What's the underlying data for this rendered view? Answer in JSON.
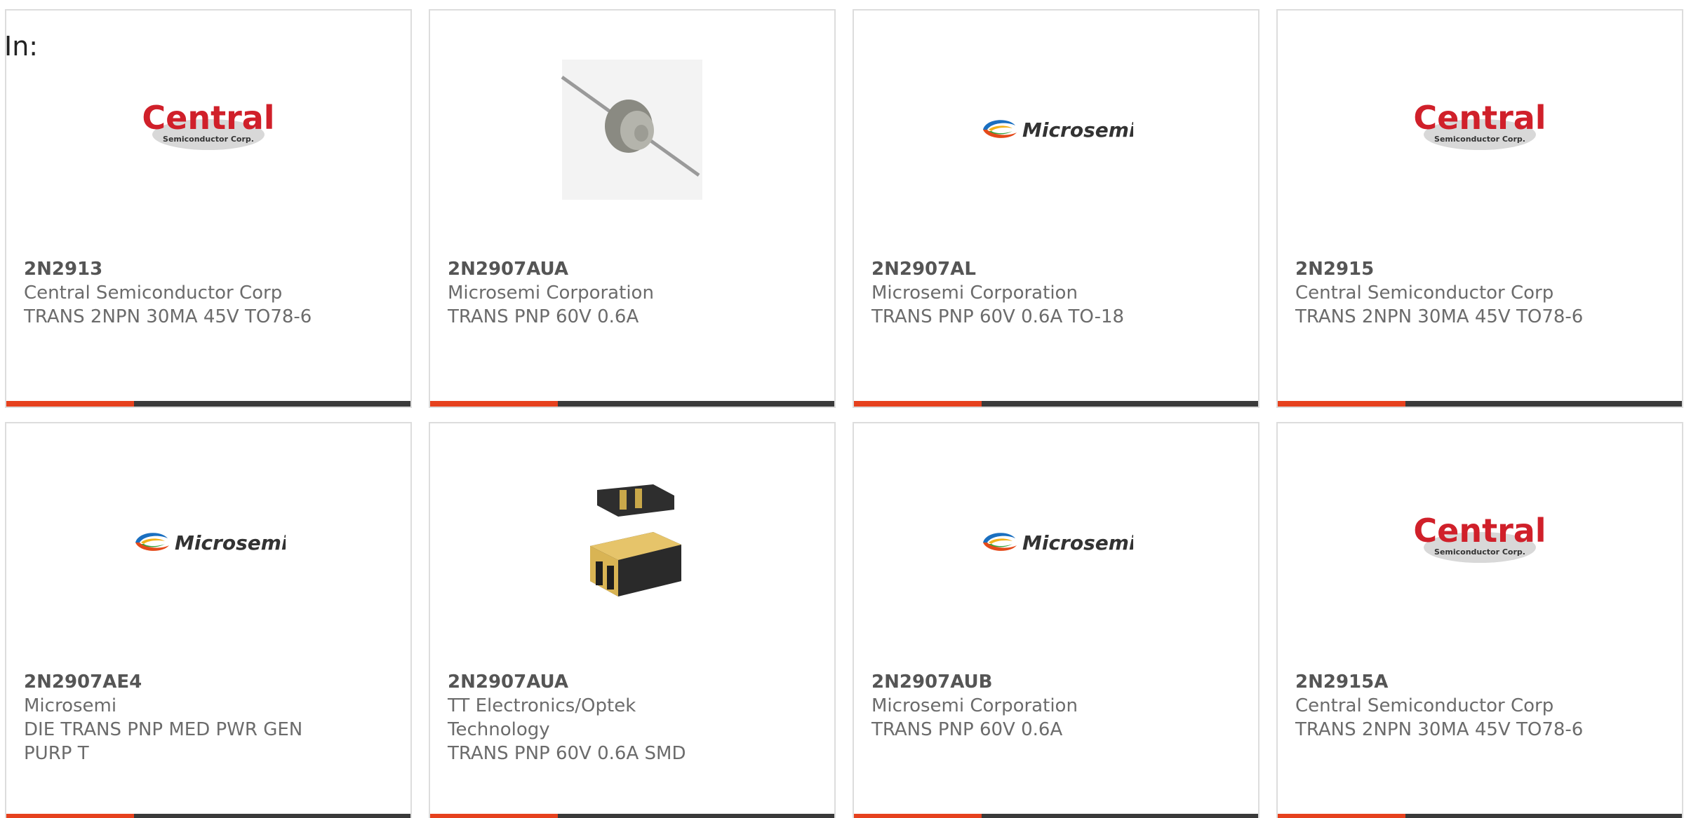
{
  "header": {
    "in_label": "In:"
  },
  "colors": {
    "accent": "#e6411e",
    "bar": "#3a3a3a",
    "border": "#dddddd"
  },
  "cards": [
    {
      "part": "2N2913",
      "manufacturer": "Central Semiconductor Corp",
      "description": "TRANS 2NPN 30MA 45V TO78-6",
      "logo": "central-logo",
      "logo_text": "Central",
      "logo_subtext": "Semiconductor Corp."
    },
    {
      "part": "2N2907AUA",
      "manufacturer": "Microsemi Corporation",
      "description": "TRANS PNP 60V 0.6A",
      "logo": "axial-component-image"
    },
    {
      "part": "2N2907AL",
      "manufacturer": "Microsemi Corporation",
      "description": "TRANS PNP 60V 0.6A TO-18",
      "logo": "microsemi-logo",
      "logo_text": "Microsemi"
    },
    {
      "part": "2N2915",
      "manufacturer": "Central Semiconductor Corp",
      "description": "TRANS 2NPN 30MA 45V TO78-6",
      "logo": "central-logo",
      "logo_text": "Central",
      "logo_subtext": "Semiconductor Corp."
    },
    {
      "part": "2N2907AE4",
      "manufacturer": "Microsemi",
      "description": "DIE TRANS PNP MED PWR GEN PURP T",
      "logo": "microsemi-logo",
      "logo_text": "Microsemi"
    },
    {
      "part": "2N2907AUA",
      "manufacturer": "TT Electronics/Optek Technology",
      "description": "TRANS PNP 60V 0.6A SMD",
      "logo": "smd-component-image"
    },
    {
      "part": "2N2907AUB",
      "manufacturer": "Microsemi Corporation",
      "description": "TRANS PNP 60V 0.6A",
      "logo": "microsemi-logo",
      "logo_text": "Microsemi"
    },
    {
      "part": "2N2915A",
      "manufacturer": "Central Semiconductor Corp",
      "description": "TRANS 2NPN 30MA 45V TO78-6",
      "logo": "central-logo",
      "logo_text": "Central",
      "logo_subtext": "Semiconductor Corp."
    }
  ]
}
